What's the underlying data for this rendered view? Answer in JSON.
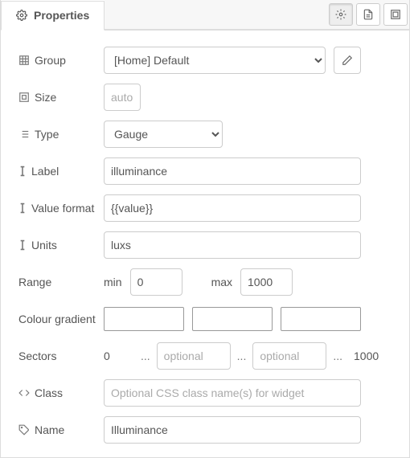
{
  "tab_title": "Properties",
  "fields": {
    "group": {
      "label": "Group",
      "value": "[Home] Default"
    },
    "size": {
      "label": "Size",
      "placeholder": "auto"
    },
    "type": {
      "label": "Type",
      "value": "Gauge"
    },
    "label": {
      "label": "Label",
      "value": "illuminance"
    },
    "value_format": {
      "label": "Value format",
      "value": "{{value}}"
    },
    "units": {
      "label": "Units",
      "value": "luxs"
    },
    "range": {
      "label": "Range",
      "min_label": "min",
      "min": "0",
      "max_label": "max",
      "max": "1000"
    },
    "gradient": {
      "label": "Colour gradient",
      "c1": "#000000",
      "c2": "#8a8a86",
      "c3": "#d7d7d3"
    },
    "sectors": {
      "label": "Sectors",
      "start": "0",
      "sep": "...",
      "opt_placeholder": "optional",
      "end": "1000"
    },
    "class_": {
      "label": "Class",
      "placeholder": "Optional CSS class name(s) for widget"
    },
    "name": {
      "label": "Name",
      "value": "Illuminance"
    }
  }
}
